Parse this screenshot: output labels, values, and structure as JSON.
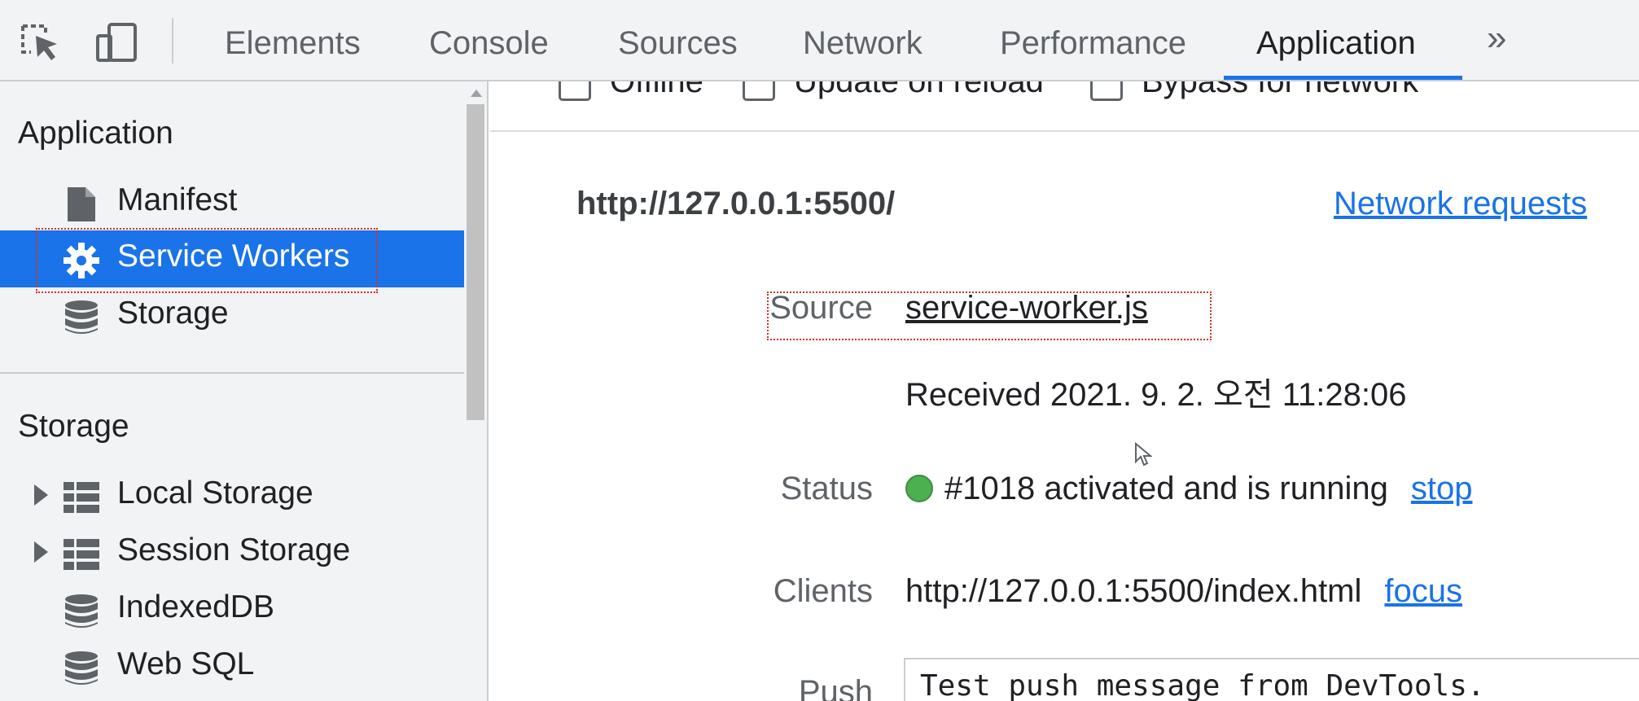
{
  "toolbar": {
    "inspect_icon": "element-picker-icon",
    "device_icon": "device-toggle-icon",
    "tabs": [
      {
        "label": "Elements"
      },
      {
        "label": "Console"
      },
      {
        "label": "Sources"
      },
      {
        "label": "Network"
      },
      {
        "label": "Performance"
      },
      {
        "label": "Application"
      }
    ],
    "active_tab": "Application",
    "more_label": "»"
  },
  "sidebar": {
    "application_title": "Application",
    "application_items": [
      {
        "label": "Manifest",
        "icon": "file-icon"
      },
      {
        "label": "Service Workers",
        "icon": "gear-icon",
        "selected": true
      },
      {
        "label": "Storage",
        "icon": "database-icon"
      }
    ],
    "storage_title": "Storage",
    "storage_items": [
      {
        "label": "Local Storage",
        "icon": "grid-icon",
        "expandable": true
      },
      {
        "label": "Session Storage",
        "icon": "grid-icon",
        "expandable": true
      },
      {
        "label": "IndexedDB",
        "icon": "database-icon",
        "expandable": false
      },
      {
        "label": "Web SQL",
        "icon": "database-icon",
        "expandable": false
      }
    ]
  },
  "main": {
    "options": {
      "offline": "Offline",
      "update_on_reload": "Update on reload",
      "bypass_for_network": "Bypass for network"
    },
    "origin": "http://127.0.0.1:5500/",
    "network_requests_link": "Network requests",
    "source_label": "Source",
    "source_link": "service-worker.js",
    "received": "Received 2021. 9. 2. 오전 11:28:06",
    "status_label": "Status",
    "status_text": "#1018 activated and is running",
    "stop_link": "stop",
    "clients_label": "Clients",
    "clients_url": "http://127.0.0.1:5500/index.html",
    "focus_link": "focus",
    "push_label": "Push",
    "push_value": "Test push message from DevTools."
  },
  "colors": {
    "accent": "#1a73e8",
    "status_running": "#4caf50",
    "focus_outline": "#d93025"
  }
}
